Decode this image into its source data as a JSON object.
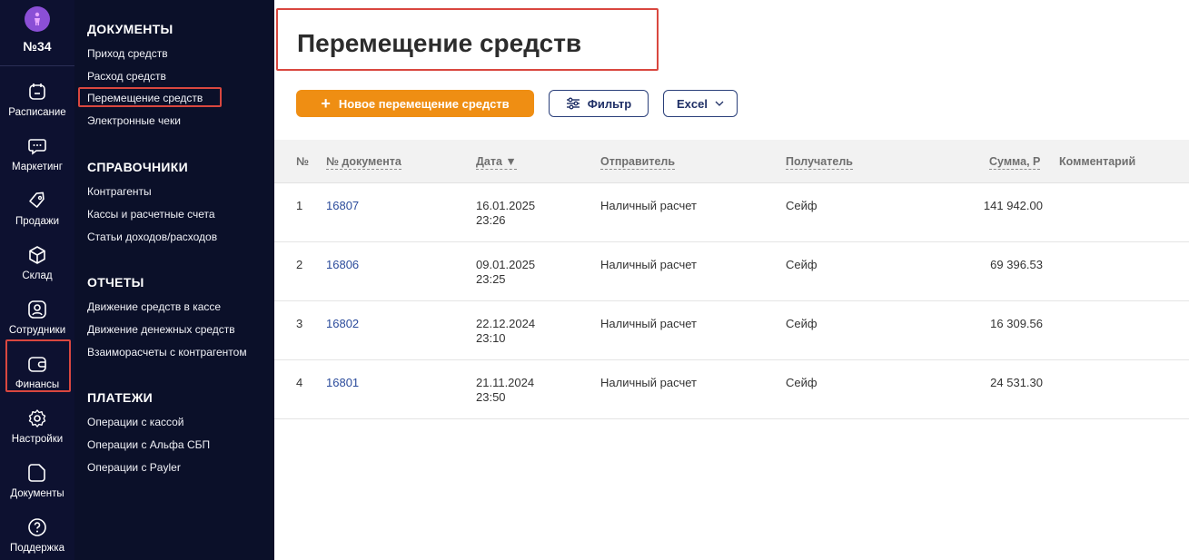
{
  "rail": {
    "club": "№34",
    "items": [
      {
        "label": "Расписание",
        "icon": "calendar-icon"
      },
      {
        "label": "Маркетинг",
        "icon": "chat-icon"
      },
      {
        "label": "Продажи",
        "icon": "tag-icon"
      },
      {
        "label": "Склад",
        "icon": "box-icon"
      },
      {
        "label": "Сотрудники",
        "icon": "user-icon"
      },
      {
        "label": "Финансы",
        "icon": "wallet-icon"
      },
      {
        "label": "Настройки",
        "icon": "gear-icon"
      },
      {
        "label": "Документы",
        "icon": "document-icon"
      },
      {
        "label": "Поддержка",
        "icon": "question-icon"
      }
    ]
  },
  "menu": {
    "sections": [
      {
        "title": "ДОКУМЕНТЫ",
        "links": [
          "Приход средств",
          "Расход средств",
          "Перемещение средств",
          "Электронные чеки"
        ]
      },
      {
        "title": "СПРАВОЧНИКИ",
        "links": [
          "Контрагенты",
          "Кассы и расчетные счета",
          "Статьи доходов/расходов"
        ]
      },
      {
        "title": "ОТЧЕТЫ",
        "links": [
          "Движение средств в кассе",
          "Движение денежных средств",
          "Взаиморасчеты с контрагентом"
        ]
      },
      {
        "title": "ПЛАТЕЖИ",
        "links": [
          "Операции с кассой",
          "Операции с Альфа СБП",
          "Операции с Payler"
        ]
      }
    ]
  },
  "page": {
    "title": "Перемещение средств",
    "new_button": "Новое перемещение средств",
    "filter_button": "Фильтр",
    "excel_button": "Excel"
  },
  "table": {
    "headers": [
      "№",
      "№ документа",
      "Дата ▼",
      "Отправитель",
      "Получатель",
      "Сумма, Р",
      "Комментарий"
    ],
    "rows": [
      {
        "n": "1",
        "doc": "16807",
        "date": "16.01.2025",
        "time": "23:26",
        "sender": "Наличный расчет",
        "receiver": "Сейф",
        "sum": "141 942.00",
        "comment": ""
      },
      {
        "n": "2",
        "doc": "16806",
        "date": "09.01.2025",
        "time": "23:25",
        "sender": "Наличный расчет",
        "receiver": "Сейф",
        "sum": "69 396.53",
        "comment": ""
      },
      {
        "n": "3",
        "doc": "16802",
        "date": "22.12.2024",
        "time": "23:10",
        "sender": "Наличный расчет",
        "receiver": "Сейф",
        "sum": "16 309.56",
        "comment": ""
      },
      {
        "n": "4",
        "doc": "16801",
        "date": "21.11.2024",
        "time": "23:50",
        "sender": "Наличный расчет",
        "receiver": "Сейф",
        "sum": "24 531.30",
        "comment": ""
      }
    ]
  },
  "colors": {
    "accent": "#ef8e13",
    "sidebar": "#0d1130",
    "highlight": "#d9473f",
    "link": "#2b4b9b"
  }
}
